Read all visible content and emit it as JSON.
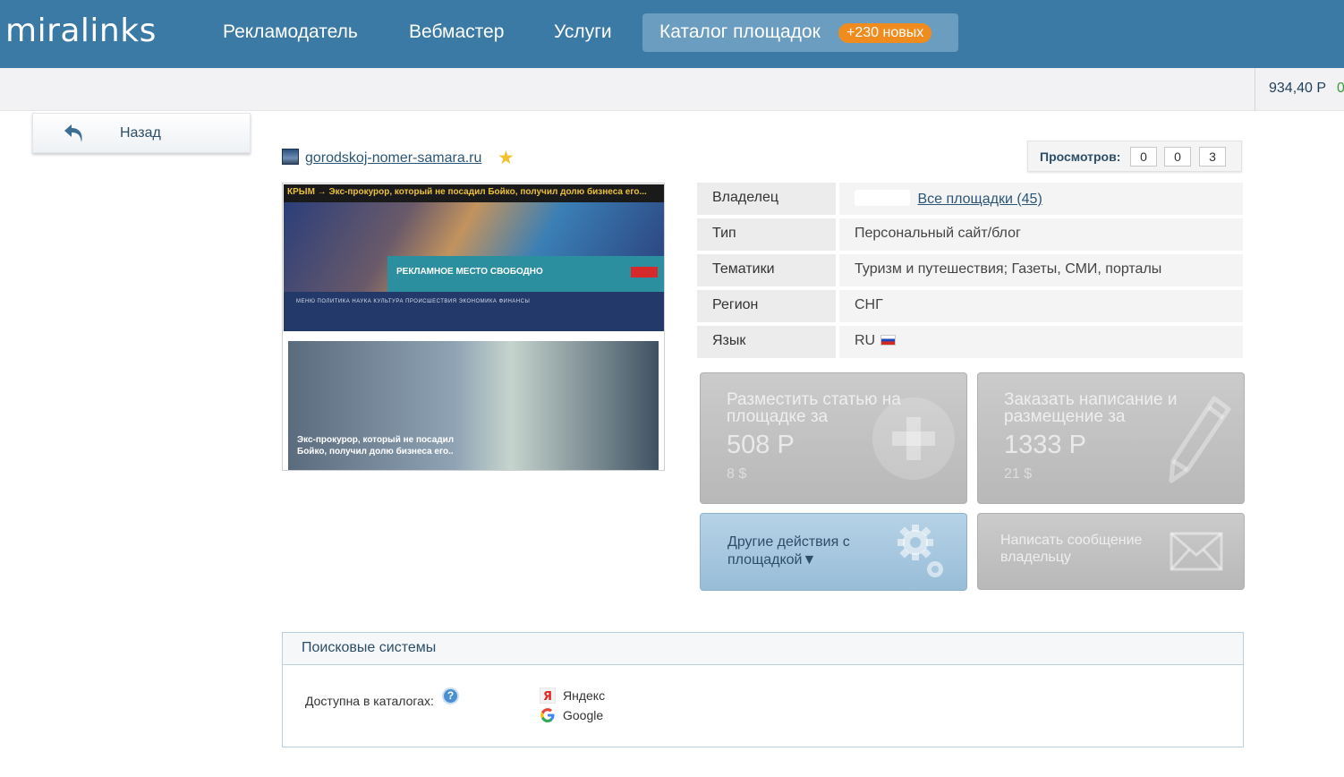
{
  "header": {
    "logo": "miralinks",
    "nav": [
      "Рекламодатель",
      "Вебмастер",
      "Услуги"
    ],
    "catalog_label": "Каталог площадок",
    "catalog_badge": "+230 новых"
  },
  "subbar": {
    "balance": "934,40 Р",
    "balance_extra": "0"
  },
  "back": {
    "label": "Назад"
  },
  "site": {
    "url": "gorodskoj-nomer-samara.ru",
    "views_label": "Просмотров:",
    "views": [
      "0",
      "0",
      "3"
    ]
  },
  "preview": {
    "header_text": "КРЫМ →   Экс-прокурор, который не посадил Бойко, получил долю бизнеса его...",
    "ad_text": "РЕКЛАМНОЕ МЕСТО СВОБОДНО",
    "menu_text": "МЕНЮ   ПОЛИТИКА   НАУКА   КУЛЬТУРА   ПРОИСШЕСТВИЯ   ЭКОНОМИКА   ФИНАНСЫ",
    "body_text": "Экс-прокурор, который не посадил Бойко, получил долю бизнеса его.."
  },
  "info": [
    {
      "key": "Владелец",
      "value": "",
      "link": "Все площадки (45)"
    },
    {
      "key": "Тип",
      "value": "Персональный сайт/блог"
    },
    {
      "key": "Тематики",
      "value": "Туризм и путешествия; Газеты, СМИ, порталы"
    },
    {
      "key": "Регион",
      "value": "СНГ"
    },
    {
      "key": "Язык",
      "value": "RU"
    }
  ],
  "actions": {
    "place": {
      "title": "Разместить статью на площадке за",
      "price": "508 Р",
      "usd": "8 $"
    },
    "order": {
      "title": "Заказать написание и размещение за",
      "price": "1333 Р",
      "usd": "21 $"
    },
    "other": {
      "title": "Другие действия с площадкой▼"
    },
    "message": {
      "title": "Написать сообщение владельцу"
    }
  },
  "search_systems": {
    "title": "Поисковые системы",
    "catalog_label": "Доступна в каталогах:",
    "help": "?",
    "engines": [
      "Яндекс",
      "Google"
    ]
  },
  "colors": {
    "header_bg": "#3c7aa6",
    "badge": "#f08c1e",
    "link": "#2b5678"
  }
}
